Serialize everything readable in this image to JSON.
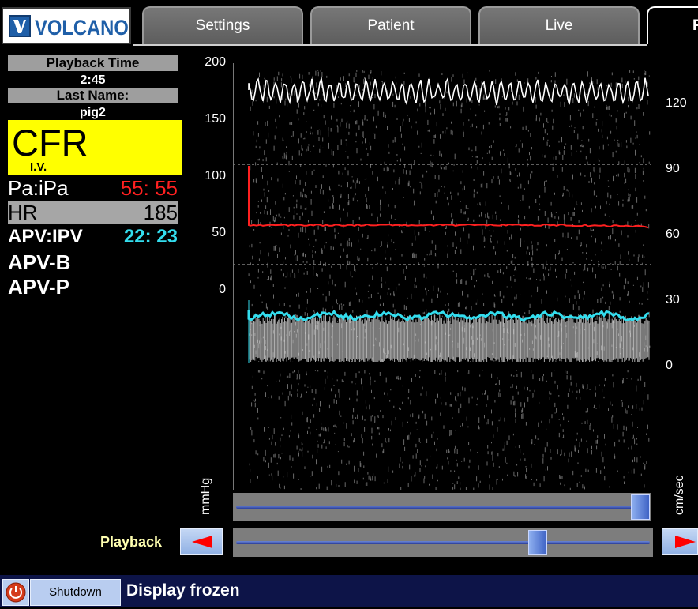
{
  "brand": {
    "name": "VOLCANO",
    "color": "#1f5fa8"
  },
  "tabs": [
    {
      "label": "Settings"
    },
    {
      "label": "Patient"
    },
    {
      "label": "Live"
    },
    {
      "label": "F"
    }
  ],
  "left_panel": {
    "playback_time_label": "Playback Time",
    "playback_time_value": "2:45",
    "last_name_label": "Last Name:",
    "last_name_value": "pig2",
    "mode_title": "CFR",
    "mode_sub": "I.V.",
    "pa_label": "Pa:iPa",
    "pa_value": "55: 55",
    "hr_label": "HR",
    "hr_value": "185",
    "apv_label": "APV:IPV",
    "apv_value": "22: 23",
    "apv_b": "APV-B",
    "apv_p": "APV-P",
    "colors": {
      "mode_bg": "#ffff00",
      "pressure": "#ff2020",
      "velocity": "#33ddee"
    }
  },
  "plot": {
    "left_axis_unit": "mmHg",
    "right_axis_unit": "cm/sec",
    "left_ticks": [
      "200",
      "150",
      "100",
      "50",
      "0"
    ],
    "right_ticks": [
      "120",
      "90",
      "60",
      "30",
      "0"
    ]
  },
  "scroll_slider": {
    "position": 1.0
  },
  "playback": {
    "label": "Playback",
    "position": 0.74,
    "prev_icon": "left-arrow-icon",
    "next_icon": "right-arrow-icon"
  },
  "status_bar": {
    "power_icon": "power-icon",
    "shutdown_label": "Shutdown",
    "message": "Display frozen"
  }
}
